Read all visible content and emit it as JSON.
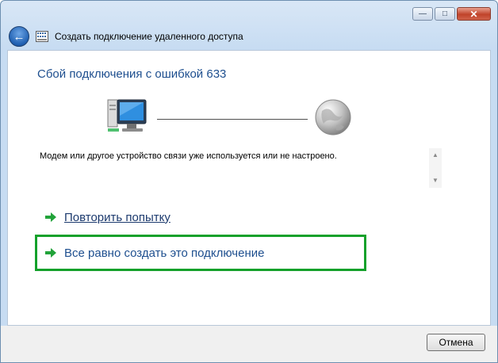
{
  "window": {
    "title": "Создать подключение удаленного доступа",
    "caption_buttons": {
      "minimize": "—",
      "maximize": "□",
      "close": "✕"
    }
  },
  "main": {
    "heading": "Сбой подключения с ошибкой 633",
    "message": "Модем или другое устройство связи уже используется или не настроено.",
    "links": {
      "retry": "Повторить попытку",
      "create_anyway": "Все равно создать это подключение"
    }
  },
  "footer": {
    "cancel_label": "Отмена"
  },
  "icons": {
    "back": "back-arrow-icon",
    "app": "dialup-connection-icon",
    "computer": "computer-icon",
    "globe": "globe-icon",
    "link_arrow": "green-arrow-icon"
  },
  "colors": {
    "heading": "#1e4f8f",
    "link": "#1c3a6e",
    "link_arrow": "#22a33a",
    "highlight_border": "#14a12b",
    "close_button": "#c0432a"
  }
}
